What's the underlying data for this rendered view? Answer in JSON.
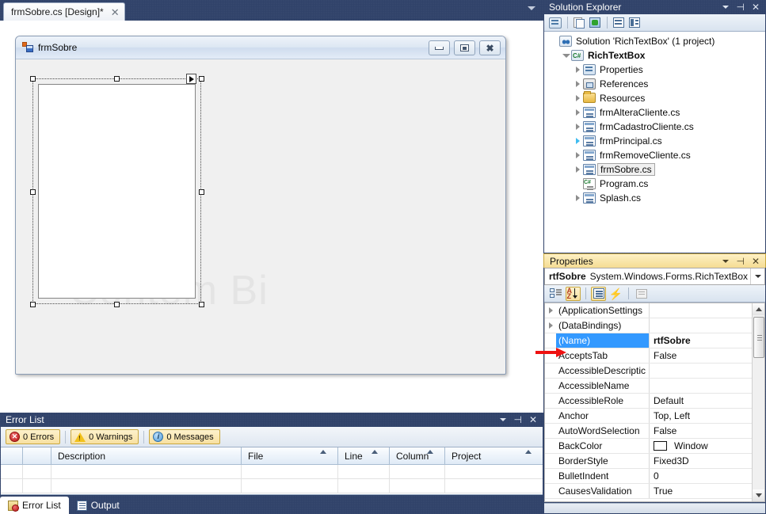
{
  "tabstrip": {
    "tab_label": "frmSobre.cs [Design]*",
    "close_glyph": "✕",
    "dropdown_icon": "chevron-down-icon"
  },
  "designer": {
    "form_title": "frmSobre",
    "window_buttons": {
      "minimize": "minimize-button",
      "maximize": "maximize-button",
      "close": "close-button"
    },
    "watermark_text": "Contém Bi",
    "selected_control": "rtfSobre"
  },
  "error_list": {
    "title": "Error List",
    "filters": [
      {
        "label": "0 Errors",
        "icon": "error-icon",
        "active": true
      },
      {
        "label": "0 Warnings",
        "icon": "warning-icon",
        "active": true
      },
      {
        "label": "0 Messages",
        "icon": "information-icon",
        "active": true
      }
    ],
    "columns": [
      "Description",
      "File",
      "Line",
      "Column",
      "Project"
    ],
    "rows": [],
    "tabs": [
      {
        "label": "Error List",
        "active": true
      },
      {
        "label": "Output",
        "active": false
      }
    ]
  },
  "solution_explorer": {
    "title": "Solution Explorer",
    "toolbar_icons": [
      "properties-window-icon",
      "show-all-files-icon",
      "refresh-icon",
      "view-code-icon",
      "view-designer-icon"
    ],
    "tree": [
      {
        "label": "Solution 'RichTextBox' (1 project)",
        "icon": "solution-icon",
        "indent": 0,
        "expander": "none",
        "bold": false,
        "selected": false
      },
      {
        "label": "RichTextBox",
        "icon": "project-icon",
        "indent": 1,
        "expander": "expanded",
        "bold": true,
        "selected": false
      },
      {
        "label": "Properties",
        "icon": "properties-folder-icon",
        "indent": 2,
        "expander": "collapsed",
        "bold": false,
        "selected": false
      },
      {
        "label": "References",
        "icon": "references-icon",
        "indent": 2,
        "expander": "collapsed",
        "bold": false,
        "selected": false
      },
      {
        "label": "Resources",
        "icon": "folder-icon",
        "indent": 2,
        "expander": "collapsed",
        "bold": false,
        "selected": false
      },
      {
        "label": "frmAlteraCliente.cs",
        "icon": "form-file-icon",
        "indent": 2,
        "expander": "collapsed",
        "bold": false,
        "selected": false
      },
      {
        "label": "frmCadastroCliente.cs",
        "icon": "form-file-icon",
        "indent": 2,
        "expander": "collapsed",
        "bold": false,
        "selected": false
      },
      {
        "label": "frmPrincipal.cs",
        "icon": "form-file-icon",
        "indent": 2,
        "expander": "collapsed-highlight",
        "bold": false,
        "selected": false
      },
      {
        "label": "frmRemoveCliente.cs",
        "icon": "form-file-icon",
        "indent": 2,
        "expander": "collapsed",
        "bold": false,
        "selected": false
      },
      {
        "label": "frmSobre.cs",
        "icon": "form-file-icon",
        "indent": 2,
        "expander": "collapsed",
        "bold": false,
        "selected": true
      },
      {
        "label": "Program.cs",
        "icon": "csharp-file-icon",
        "indent": 2,
        "expander": "none",
        "bold": false,
        "selected": false
      },
      {
        "label": "Splash.cs",
        "icon": "form-file-icon",
        "indent": 2,
        "expander": "collapsed",
        "bold": false,
        "selected": false
      }
    ]
  },
  "properties": {
    "title": "Properties",
    "object_name": "rtfSobre",
    "object_type": "System.Windows.Forms.RichTextBox",
    "toolbar_icons": [
      "categorized-icon",
      "alphabetical-icon",
      "properties-icon",
      "events-icon",
      "property-pages-icon"
    ],
    "rows": [
      {
        "name": "(ApplicationSettings",
        "value": "",
        "expander": true,
        "selected": false,
        "swatch": null
      },
      {
        "name": "(DataBindings)",
        "value": "",
        "expander": true,
        "selected": false,
        "swatch": null
      },
      {
        "name": "(Name)",
        "value": "rtfSobre",
        "expander": false,
        "selected": true,
        "swatch": null
      },
      {
        "name": "AcceptsTab",
        "value": "False",
        "expander": false,
        "selected": false,
        "swatch": null
      },
      {
        "name": "AccessibleDescriptic",
        "value": "",
        "expander": false,
        "selected": false,
        "swatch": null
      },
      {
        "name": "AccessibleName",
        "value": "",
        "expander": false,
        "selected": false,
        "swatch": null
      },
      {
        "name": "AccessibleRole",
        "value": "Default",
        "expander": false,
        "selected": false,
        "swatch": null
      },
      {
        "name": "Anchor",
        "value": "Top, Left",
        "expander": false,
        "selected": false,
        "swatch": null
      },
      {
        "name": "AutoWordSelection",
        "value": "False",
        "expander": false,
        "selected": false,
        "swatch": null
      },
      {
        "name": "BackColor",
        "value": "Window",
        "expander": false,
        "selected": false,
        "swatch": "#ffffff"
      },
      {
        "name": "BorderStyle",
        "value": "Fixed3D",
        "expander": false,
        "selected": false,
        "swatch": null
      },
      {
        "name": "BulletIndent",
        "value": "0",
        "expander": false,
        "selected": false,
        "swatch": null
      },
      {
        "name": "CausesValidation",
        "value": "True",
        "expander": false,
        "selected": false,
        "swatch": null
      }
    ]
  },
  "annotation": {
    "arrow_color": "#ee1111",
    "points_at": "(Name)"
  },
  "panel_controls": {
    "chevron": "chevron-down-icon",
    "pin": "⊣",
    "close": "✕"
  }
}
